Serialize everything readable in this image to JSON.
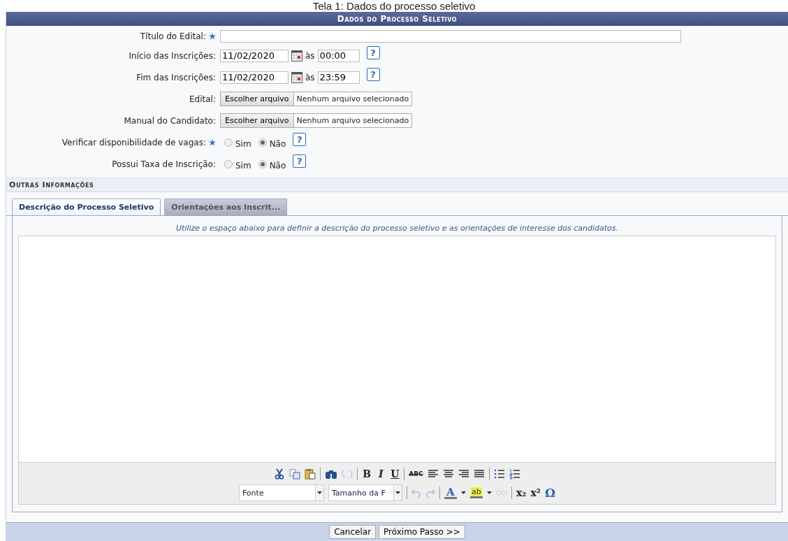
{
  "caption": "Tela 1: Dados do processo seletivo",
  "section": {
    "title": "Dados do Processo Seletivo"
  },
  "fields": [
    {
      "kind": "text",
      "label": "Título do Edital:",
      "required": true
    },
    {
      "kind": "datetime",
      "label": "Início das Inscrições:",
      "required": false,
      "date": "11/02/2020",
      "joiner": "às",
      "time": "00:00",
      "help": "?"
    },
    {
      "kind": "datetime",
      "label": "Fim das Inscrições:",
      "required": false,
      "date": "11/02/2020",
      "joiner": "às",
      "time": "23:59",
      "help": "?"
    },
    {
      "kind": "file",
      "label": "Edital:",
      "required": false,
      "button": "Escolher arquivo",
      "status": "Nenhum arquivo selecionado"
    },
    {
      "kind": "file",
      "label": "Manual do Candidato:",
      "required": false,
      "button": "Escolher arquivo",
      "status": "Nenhum arquivo selecionado"
    },
    {
      "kind": "radio",
      "label": "Verificar disponibilidade de vagas:",
      "required": true,
      "options": [
        {
          "label": "Sim",
          "selected": false
        },
        {
          "label": "Não",
          "selected": true
        }
      ],
      "help": "?"
    },
    {
      "kind": "radio",
      "label": "Possui Taxa de Inscrição:",
      "required": false,
      "options": [
        {
          "label": "Sim",
          "selected": false
        },
        {
          "label": "Não",
          "selected": true
        }
      ],
      "help": "?"
    }
  ],
  "subsection": {
    "title": "Outras Informações"
  },
  "tabs": [
    {
      "label": "Descrição do Processo Seletivo",
      "selected": true
    },
    {
      "label": "Orientações aos Inscrit...",
      "selected": false
    }
  ],
  "editor": {
    "hint": "Utilize o espaço abaixo para definir a descrição do processo seletivo e as orientações de interesse dos candidatos.",
    "toolbar": {
      "bold": "B",
      "italic": "I",
      "underline": "U",
      "strike": "ABC",
      "font": "Fonte",
      "size": "Tamanho da F",
      "text_color": "A",
      "bg_color": "ab",
      "subscript": "x₂",
      "superscript": "x²",
      "special_char": "Ω"
    }
  },
  "buttons": [
    "Cancelar",
    "Próximo Passo >>"
  ]
}
